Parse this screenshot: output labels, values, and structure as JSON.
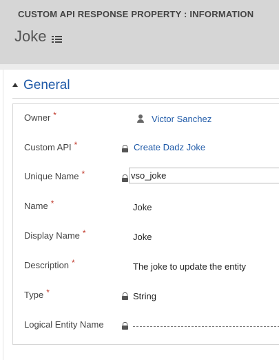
{
  "header": {
    "entity_title": "CUSTOM API RESPONSE PROPERTY : INFORMATION",
    "record_name": "Joke",
    "menu_icon": "hamburger-menu-icon"
  },
  "section": {
    "title": "General",
    "chevron_icon": "collapse-triangle-icon"
  },
  "fields": {
    "owner": {
      "label": "Owner",
      "required": "*",
      "value": "Victor Sanchez",
      "icon": "user-icon"
    },
    "custom_api": {
      "label": "Custom API",
      "required": "*",
      "value": "Create Dadz Joke",
      "icon": "lock-icon"
    },
    "unique_name": {
      "label": "Unique Name",
      "required": "*",
      "value": "vso_joke",
      "icon": "lock-icon"
    },
    "name": {
      "label": "Name",
      "required": "*",
      "value": "Joke"
    },
    "display_name": {
      "label": "Display Name",
      "required": "*",
      "value": "Joke"
    },
    "description": {
      "label": "Description",
      "required": "*",
      "value": "The joke to update the entity"
    },
    "type": {
      "label": "Type",
      "required": "*",
      "value": "String",
      "icon": "lock-icon"
    },
    "logical_entity_name": {
      "label": "Logical Entity Name",
      "value": "",
      "icon": "lock-icon"
    }
  },
  "colors": {
    "header_bg": "#d6d6d6",
    "link": "#1f5aa8",
    "required": "#c0392b"
  }
}
